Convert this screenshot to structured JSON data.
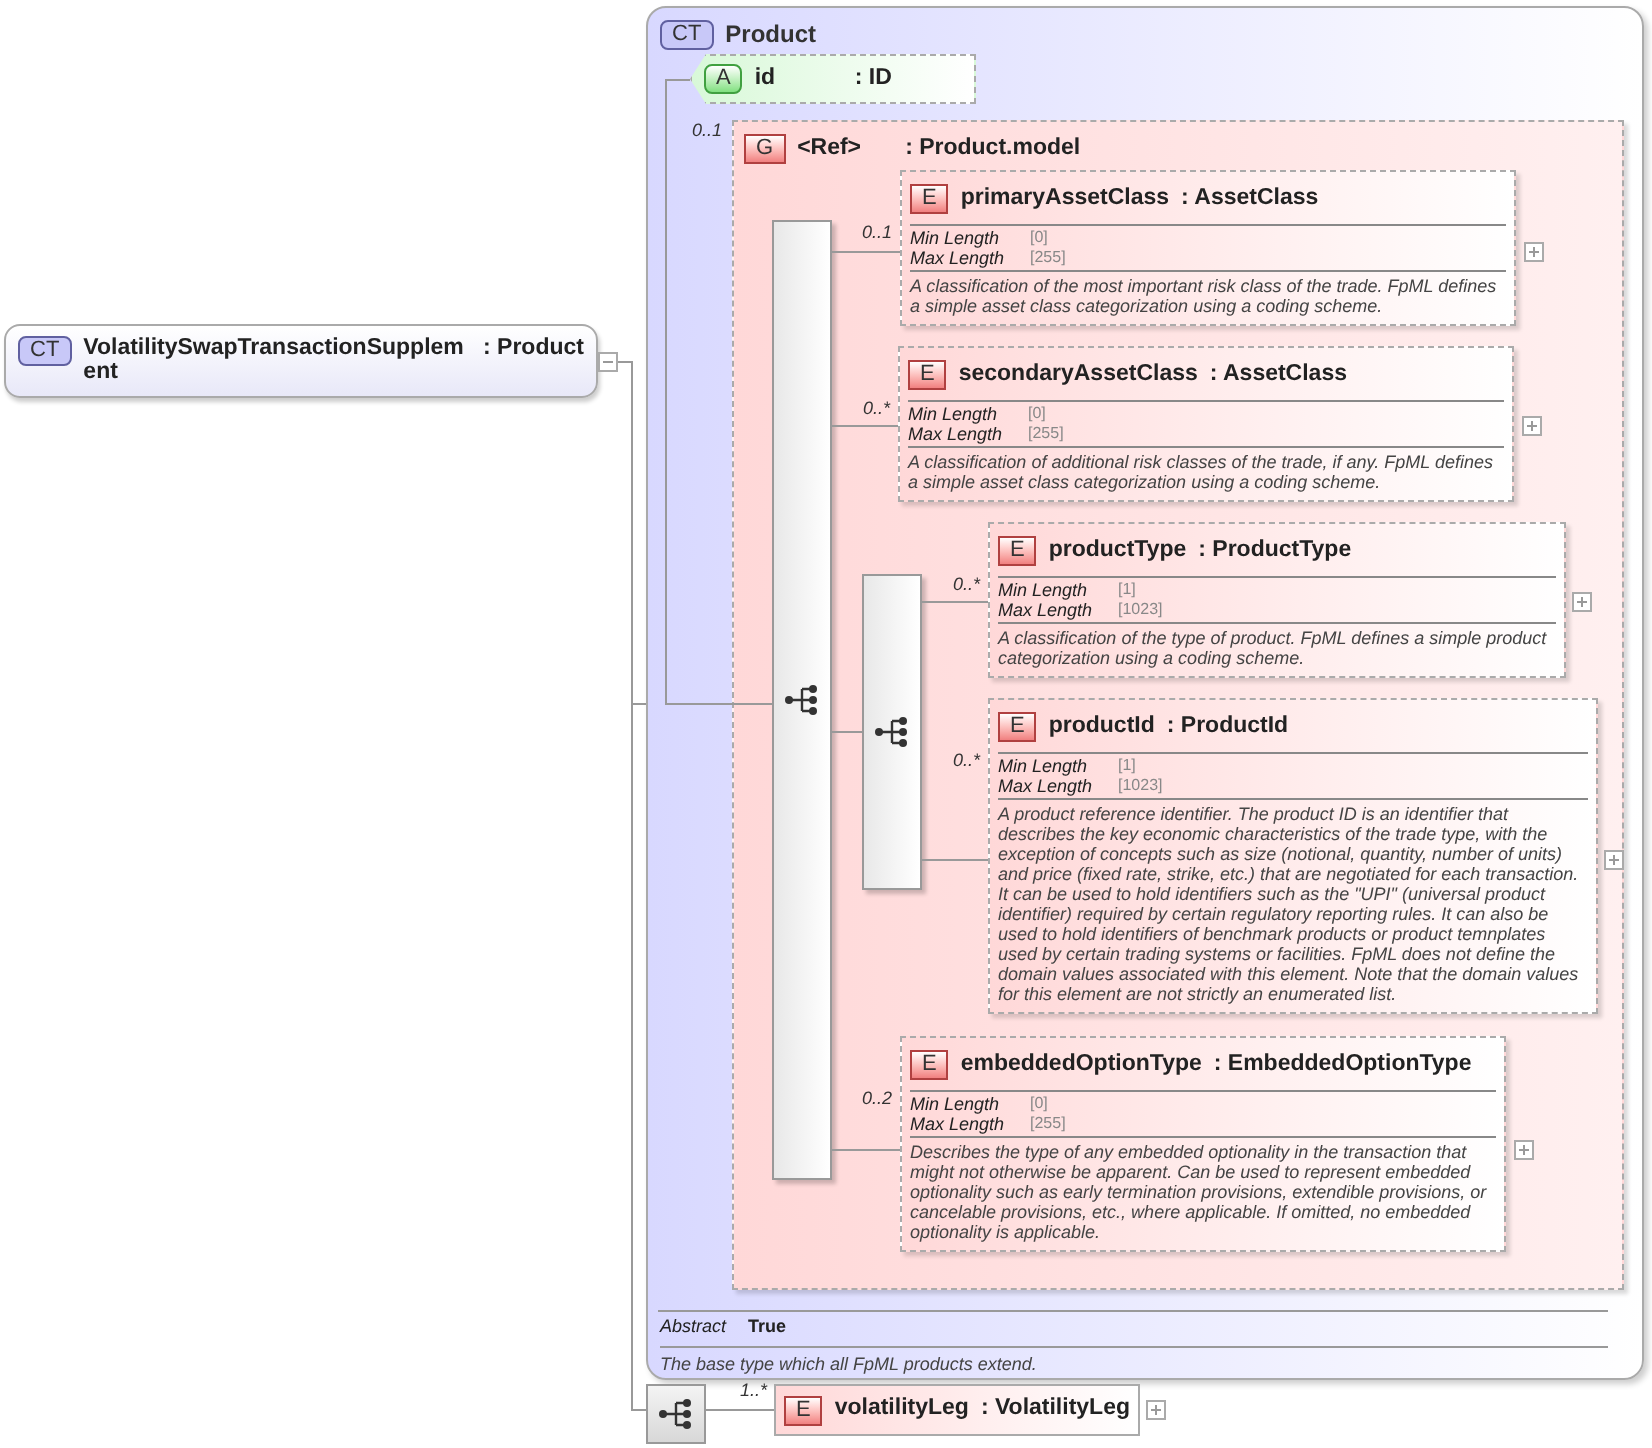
{
  "root": {
    "badge": "CT",
    "name": "VolatilitySwapTransactionSupplement",
    "type": ": Product",
    "expanded": true
  },
  "complex_type": {
    "badge": "CT",
    "name": "Product",
    "attribute": {
      "badge": "A",
      "name": "id",
      "type": ": ID"
    },
    "group": {
      "cardinality": "0..1",
      "badge": "G",
      "name": "<Ref>",
      "type": ": Product.model",
      "items": [
        {
          "kind": "element",
          "cardinality": "0..1",
          "badge": "E",
          "name": "primaryAssetClass",
          "type": ": AssetClass",
          "facets": [
            {
              "label": "Min Length",
              "value": "[0]"
            },
            {
              "label": "Max Length",
              "value": "[255]"
            }
          ],
          "description": "A classification of the most important risk class of the trade. FpML defines a simple asset class categorization using a coding scheme."
        },
        {
          "kind": "element",
          "cardinality": "0..*",
          "badge": "E",
          "name": "secondaryAssetClass",
          "type": ": AssetClass",
          "facets": [
            {
              "label": "Min Length",
              "value": "[0]"
            },
            {
              "label": "Max Length",
              "value": "[255]"
            }
          ],
          "description": "A classification of additional risk classes of the trade, if any. FpML defines a simple asset class categorization using a coding scheme."
        },
        {
          "kind": "sequence",
          "children": [
            {
              "kind": "element",
              "cardinality": "0..*",
              "badge": "E",
              "name": "productType",
              "type": ": ProductType",
              "facets": [
                {
                  "label": "Min Length",
                  "value": "[1]"
                },
                {
                  "label": "Max Length",
                  "value": "[1023]"
                }
              ],
              "description": "A classification of the type of product. FpML defines a simple product categorization using a coding scheme."
            },
            {
              "kind": "element",
              "cardinality": "0..*",
              "badge": "E",
              "name": "productId",
              "type": ": ProductId",
              "facets": [
                {
                  "label": "Min Length",
                  "value": "[1]"
                },
                {
                  "label": "Max Length",
                  "value": "[1023]"
                }
              ],
              "description": "A product reference identifier. The product ID is an identifier that describes the key economic characteristics of the trade type, with the exception of concepts such as size (notional, quantity, number of units) and price (fixed rate, strike, etc.) that are negotiated for each transaction. It can be used to hold identifiers such as the \"UPI\" (universal product identifier) required by certain regulatory reporting rules. It can also be used to hold identifiers of benchmark products or product temnplates used by certain trading systems or facilities. FpML does not define the domain values associated with this element. Note that the domain values for this element are not strictly an enumerated list."
            }
          ]
        },
        {
          "kind": "element",
          "cardinality": "0..2",
          "badge": "E",
          "name": "embeddedOptionType",
          "type": ": EmbeddedOptionType",
          "facets": [
            {
              "label": "Min Length",
              "value": "[0]"
            },
            {
              "label": "Max Length",
              "value": "[255]"
            }
          ],
          "description": "Describes the type of any embedded optionality in the transaction that might not otherwise be apparent. Can be used to represent embedded optionality such as early termination provisions, extendible provisions, or cancelable provisions, etc., where applicable. If omitted, no embedded optionality is applicable."
        }
      ]
    },
    "properties": [
      {
        "label": "Abstract",
        "value": "True"
      }
    ],
    "description": "The base type which all FpML products extend."
  },
  "sequence": {
    "cardinality": "1..*",
    "element": {
      "badge": "E",
      "name": "volatilityLeg",
      "type": ": VolatilityLeg"
    }
  }
}
